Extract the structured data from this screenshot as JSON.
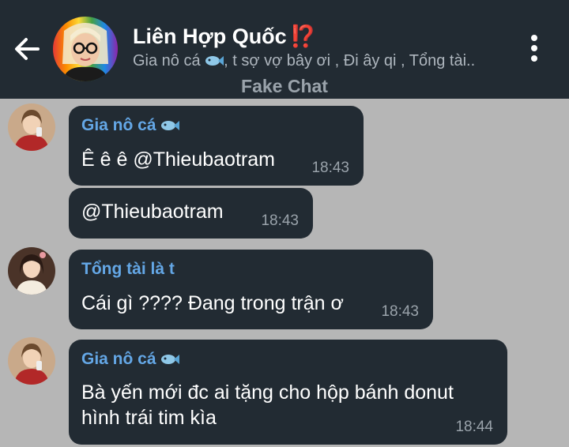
{
  "header": {
    "back_icon": "arrow-left-icon",
    "title": "Liên Hợp Quốc",
    "title_emoji": "⁉️",
    "members_text_1": "Gia nô cá ",
    "members_text_2": ", t sợ vợ bây ơi , Đi ây qi , Tổng tài..",
    "menu_icon": "more-vert-icon",
    "watermark": "Fake Chat"
  },
  "colors": {
    "header_bg": "#222b33",
    "chat_bg": "#b6b6b6",
    "bubble_bg": "#222b33",
    "sender_name": "#64a7e6",
    "timestamp": "#9aa3ab",
    "title_emoji": "#e53935"
  },
  "messages": [
    {
      "sender": "Gia nô cá",
      "sender_icon": "fish-icon",
      "text": "Ê ê ê @Thieubaotram",
      "time": "18:43"
    },
    {
      "text": "@Thieubaotram",
      "time": "18:43"
    },
    {
      "sender": "Tổng tài là t",
      "text": "Cái gì ???? Đang trong trận ơ",
      "time": "18:43"
    },
    {
      "sender": "Gia nô cá",
      "sender_icon": "fish-icon",
      "text_line1": "Bà yến mới đc ai tặng cho hộp bánh donut",
      "text_line2": "hình trái tim kìa",
      "time": "18:44"
    }
  ]
}
